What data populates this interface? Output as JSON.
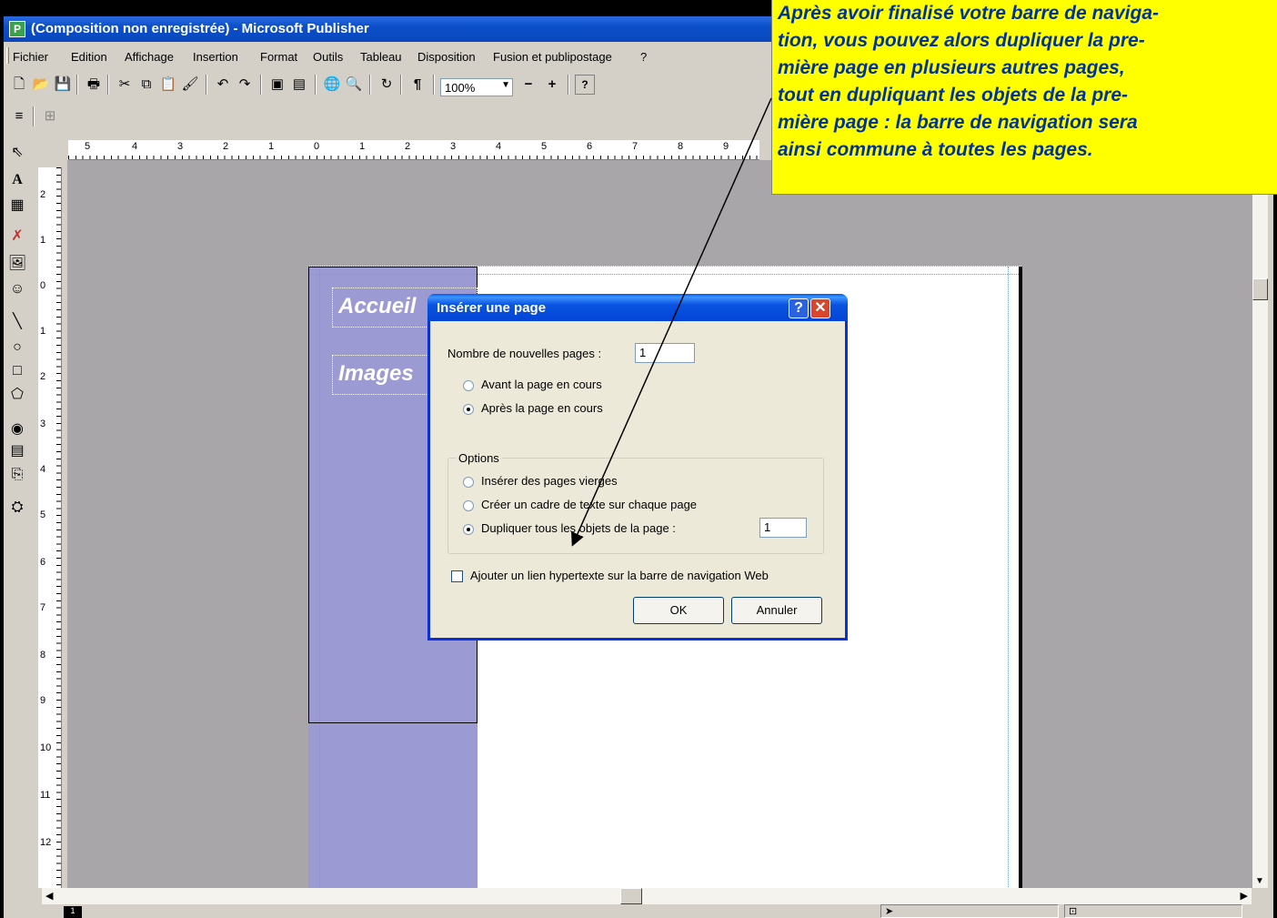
{
  "window": {
    "title": "(Composition non enregistrée) - Microsoft Publisher",
    "app_icon": "publisher-icon"
  },
  "menu": {
    "items": [
      "Fichier",
      "Edition",
      "Affichage",
      "Insertion",
      "Format",
      "Outils",
      "Tableau",
      "Disposition",
      "Fusion et publipostage",
      "?"
    ]
  },
  "toolbar": {
    "icons": [
      "new-icon",
      "open-icon",
      "save-icon",
      "print-icon",
      "cut-icon",
      "copy-icon",
      "paste-icon",
      "format-painter-icon",
      "undo-icon",
      "redo-icon",
      "bring-front-icon",
      "send-back-icon",
      "web-preview-icon",
      "print-preview-icon",
      "refresh-icon",
      "pilcrow-icon"
    ],
    "zoom_value": "100%",
    "zoom_out": "−",
    "zoom_in": "+",
    "help_symbol": "?",
    "pilcrow": "¶"
  },
  "rulers": {
    "horizontal_labels": [
      "5",
      "4",
      "3",
      "2",
      "1",
      "0",
      "1",
      "2",
      "3",
      "4",
      "5",
      "6",
      "7",
      "8",
      "9"
    ],
    "vertical_labels": [
      "2",
      "1",
      "0",
      "1",
      "2",
      "3",
      "4",
      "5",
      "6",
      "7",
      "8",
      "9",
      "10",
      "11",
      "12"
    ]
  },
  "page": {
    "nav_buttons": [
      "Accueil",
      "Images"
    ]
  },
  "status": {
    "page_number": "1"
  },
  "dialog": {
    "title": "Insérer une page",
    "help_label": "?",
    "close_label": "✕",
    "count_label": "Nombre de nouvelles pages :",
    "count_value": "1",
    "before_label": "Avant la page en cours",
    "after_label": "Après la page en cours",
    "options_label": "Options",
    "opt_blank": "Insérer des pages vierges",
    "opt_textframe": "Créer un cadre de texte sur chaque page",
    "opt_duplicate": "Dupliquer tous les objets de la page :",
    "duplicate_page_value": "1",
    "hyperlink_label": "Ajouter un lien hypertexte sur la barre de navigation Web",
    "ok_label": "OK",
    "cancel_label": "Annuler",
    "position_selected": "after",
    "option_selected": "duplicate",
    "hyperlink_checked": false
  },
  "annotation": {
    "lines": [
      "Après avoir finalisé votre barre de naviga-",
      "tion, vous pouvez alors dupliquer la pre-",
      "mière page en plusieurs autres pages,",
      "tout en dupliquant les objets de la pre-",
      "mière page : la barre de navigation sera",
      "ainsi commune à toutes les pages."
    ],
    "background": "#ffff00",
    "text_color": "#003399"
  },
  "colors": {
    "titlebar": "#0b4fc9",
    "workspace": "#a8a6a8",
    "nav_panel": "#9c9ad2",
    "dialog_bg": "#ece9d8"
  }
}
